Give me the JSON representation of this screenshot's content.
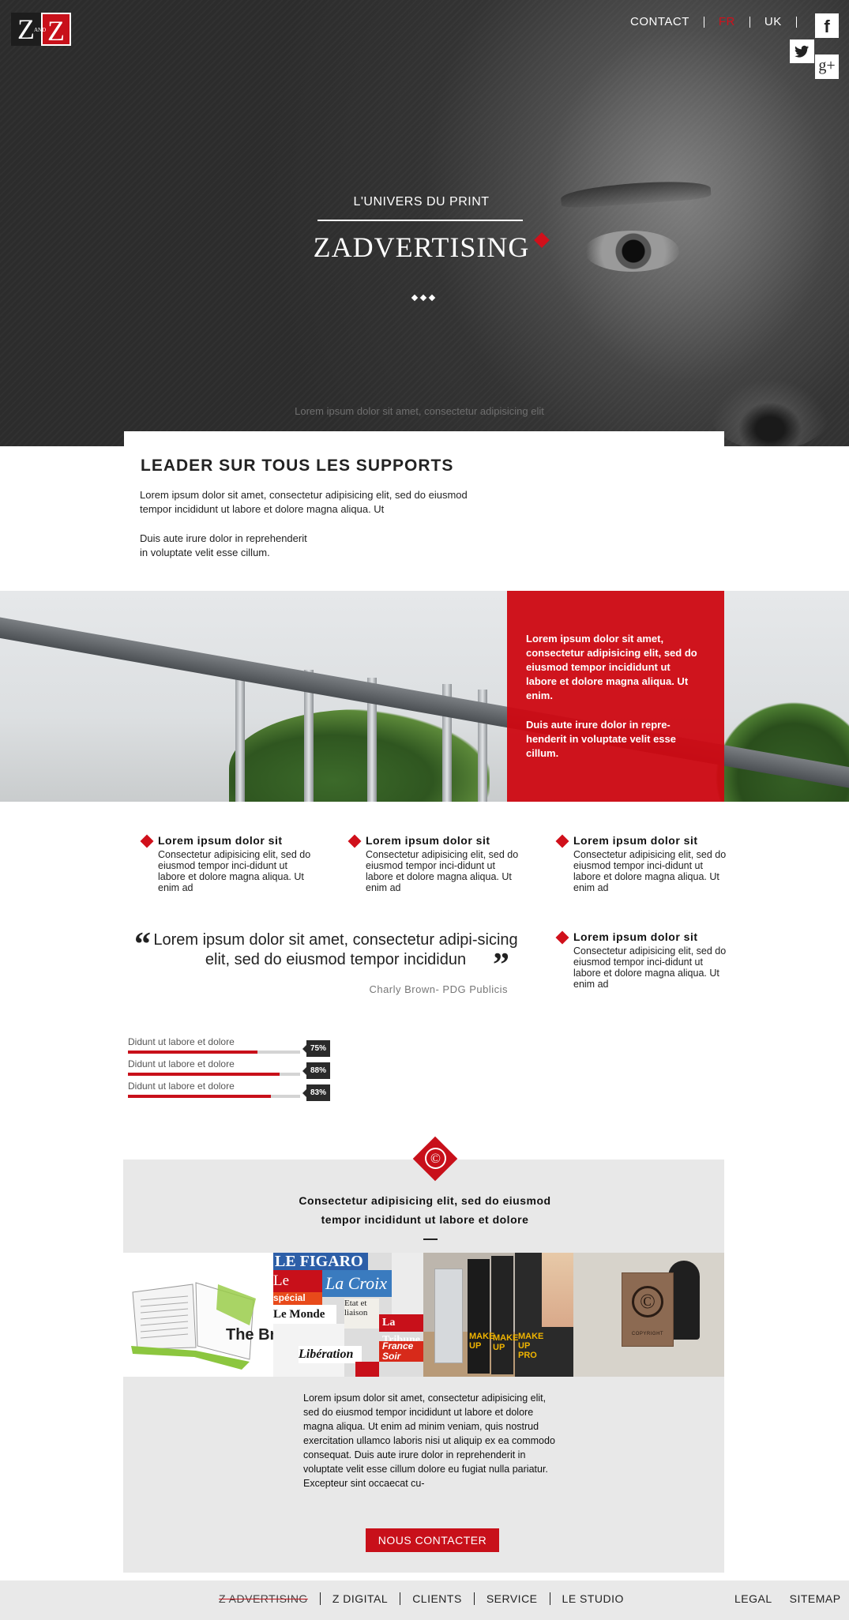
{
  "brand": {
    "logo_left": "Z",
    "logo_and": "AND",
    "logo_right": "Z"
  },
  "topnav": {
    "items": [
      {
        "label": "CONTACT",
        "active": false
      },
      {
        "label": "FR",
        "active": true
      },
      {
        "label": "UK",
        "active": false
      }
    ]
  },
  "social": {
    "facebook": "f",
    "googleplus": "g+"
  },
  "hero": {
    "subtitle": "L'UNIVERS DU PRINT",
    "title": "ZADVERTISING",
    "caption": "Lorem ipsum dolor sit amet, consectetur adipisicing elit"
  },
  "leader": {
    "title": "LEADER SUR TOUS LES SUPPORTS",
    "p1": "Lorem ipsum dolor sit amet, consectetur adipisicing elit, sed do eiusmod tempor incididunt ut labore et dolore magna aliqua. Ut",
    "p2": "Duis aute irure dolor in reprehenderit\n in voluptate velit esse cillum."
  },
  "band": {
    "p1": "Lorem ipsum dolor sit amet, consectetur adipisicing elit, sed do eiusmod tempor incididunt ut labore et dolore magna aliqua. Ut enim.",
    "p2": "Duis aute irure dolor in repre-henderit in voluptate velit esse cillum."
  },
  "features": [
    {
      "title": "Lorem ipsum dolor sit",
      "text": "Consectetur adipisicing elit, sed do eiusmod tempor inci-didunt ut labore et dolore magna aliqua. Ut enim ad"
    },
    {
      "title": "Lorem ipsum dolor sit",
      "text": "Consectetur adipisicing elit, sed do eiusmod tempor inci-didunt ut labore et dolore magna aliqua. Ut enim ad"
    },
    {
      "title": "Lorem ipsum dolor sit",
      "text": "Consectetur adipisicing elit, sed do eiusmod tempor inci-didunt ut labore et dolore magna aliqua. Ut enim ad"
    },
    {
      "title": "Lorem ipsum dolor sit",
      "text": "Consectetur adipisicing elit, sed do eiusmod tempor inci-didunt ut labore et dolore magna aliqua. Ut enim ad"
    }
  ],
  "quote": {
    "open": "“",
    "text": "Lorem ipsum dolor sit amet, consectetur adipi-sicing elit, sed do eiusmod tempor incididun",
    "close": "”",
    "author": "Charly Brown- PDG Publicis"
  },
  "skills": [
    {
      "label": "Didunt ut labore et dolore",
      "percent": 75,
      "display": "75%"
    },
    {
      "label": "Didunt ut labore et dolore",
      "percent": 88,
      "display": "88%"
    },
    {
      "label": "Didunt ut labore et dolore",
      "percent": 83,
      "display": "83%"
    }
  ],
  "gray": {
    "icon": "©",
    "heading": "Consectetur adipisicing elit, sed do eiusmod tempor incididunt ut labore et dolore",
    "tiles": [
      {
        "name": "brochure",
        "text": "The Brochure"
      },
      {
        "name": "newspapers",
        "words": [
          "LE FIGARO",
          "Le Point",
          "La Croix",
          "Le Monde",
          "La Tribune",
          "Libération",
          "France Soir",
          "Etat et liaison",
          "spécial Israël"
        ]
      },
      {
        "name": "rollup-banners",
        "words": [
          "MAKE UP",
          "MAKE UP",
          "MAKE UP PRO"
        ]
      },
      {
        "name": "copyright-sign",
        "text": "COPYRIGHT",
        "symbol": "©"
      }
    ],
    "body": "Lorem ipsum dolor sit amet, consectetur adipisicing elit, sed do eiusmod tempor incididunt ut labore et dolore magna aliqua. Ut enim ad minim veniam, quis nostrud exercitation ullamco laboris nisi ut aliquip ex ea commodo consequat. Duis aute irure dolor in reprehenderit in voluptate velit esse cillum dolore eu fugiat nulla pariatur. Excepteur sint occaecat cu-",
    "button": "NOUS CONTACTER"
  },
  "footer": {
    "nav": [
      {
        "label": "Z ADVERTISING",
        "active": true
      },
      {
        "label": "Z DIGITAL",
        "active": false
      },
      {
        "label": "CLIENTS",
        "active": false
      },
      {
        "label": "SERVICE",
        "active": false
      },
      {
        "label": "LE STUDIO",
        "active": false
      }
    ],
    "right": [
      "LEGAL",
      "SITEMAP"
    ]
  },
  "colors": {
    "accent": "#c8101a",
    "dark": "#2c2c2c",
    "gray_bg": "#e8e8e8",
    "footer_bg": "#e9e9e9"
  }
}
